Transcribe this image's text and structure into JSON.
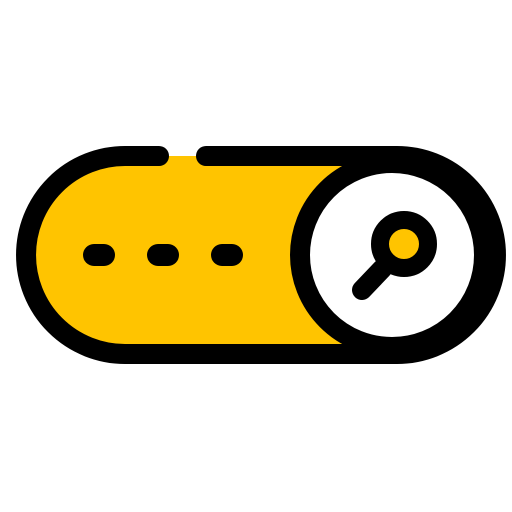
{
  "icon": {
    "name": "search-toggle-icon",
    "parts": {
      "pill": "pill-body",
      "dots": "ellipsis-dots-icon",
      "knob": "toggle-knob",
      "magnifier": "magnifier-icon"
    }
  },
  "colors": {
    "fill": "#FFC400",
    "outline": "#000000",
    "knob": "#ffffff",
    "background": "#ffffff"
  }
}
